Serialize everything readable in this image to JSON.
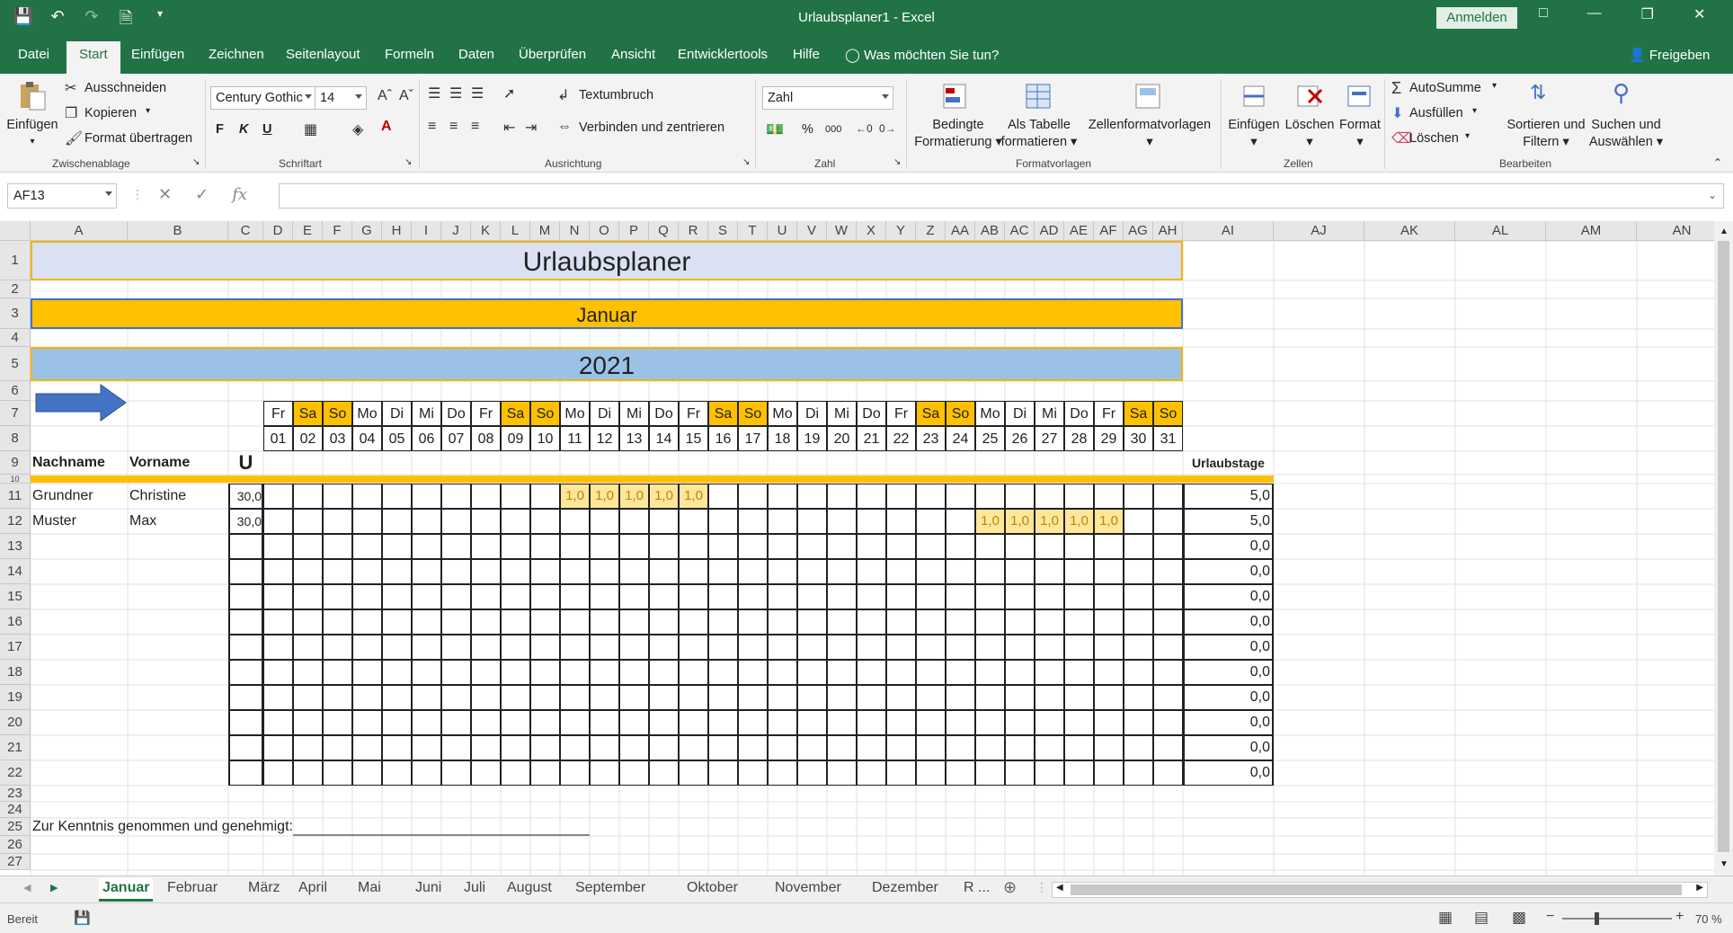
{
  "window": {
    "title": "Urlaubsplaner1  -  Excel",
    "signin": "Anmelden",
    "share": "Freigeben"
  },
  "ribbon_tabs": [
    "Datei",
    "Start",
    "Einfügen",
    "Zeichnen",
    "Seitenlayout",
    "Formeln",
    "Daten",
    "Überprüfen",
    "Ansicht",
    "Entwicklertools",
    "Hilfe",
    "Was möchten Sie tun?"
  ],
  "ribbon": {
    "clipboard": {
      "paste": "Einfügen",
      "cut": "Ausschneiden",
      "copy": "Kopieren",
      "format_painter": "Format übertragen",
      "label": "Zwischenablage"
    },
    "font": {
      "name": "Century Gothic",
      "size": "14",
      "bold": "F",
      "italic": "K",
      "underline": "U",
      "label": "Schriftart"
    },
    "alignment": {
      "wrap": "Textumbruch",
      "merge": "Verbinden und zentrieren",
      "label": "Ausrichtung"
    },
    "number": {
      "format": "Zahl",
      "percent": "%",
      "thousands": "000",
      "label": "Zahl"
    },
    "styles": {
      "conditional_1": "Bedingte",
      "conditional_2": "Formatierung",
      "table_1": "Als Tabelle",
      "table_2": "formatieren",
      "cell_styles": "Zellenformatvorlagen",
      "label": "Formatvorlagen"
    },
    "cells": {
      "insert": "Einfügen",
      "delete": "Löschen",
      "format": "Format",
      "label": "Zellen"
    },
    "editing": {
      "autosum": "AutoSumme",
      "fill": "Ausfüllen",
      "clear": "Löschen",
      "sort_1": "Sortieren und",
      "sort_2": "Filtern",
      "find_1": "Suchen und",
      "find_2": "Auswählen",
      "label": "Bearbeiten"
    }
  },
  "formula_bar": {
    "name_box": "AF13",
    "formula": ""
  },
  "columns": [
    "A",
    "B",
    "C",
    "D",
    "E",
    "F",
    "G",
    "H",
    "I",
    "J",
    "K",
    "L",
    "M",
    "N",
    "O",
    "P",
    "Q",
    "R",
    "S",
    "T",
    "U",
    "V",
    "W",
    "X",
    "Y",
    "Z",
    "AA",
    "AB",
    "AC",
    "AD",
    "AE",
    "AF",
    "AG",
    "AH",
    "AI",
    "AJ",
    "AK",
    "AL",
    "AM",
    "AN"
  ],
  "rows": [
    "1",
    "2",
    "3",
    "4",
    "5",
    "6",
    "7",
    "8",
    "9",
    "10",
    "11",
    "12",
    "13",
    "14",
    "15",
    "16",
    "17",
    "18",
    "19",
    "20",
    "21",
    "22",
    "23",
    "24",
    "25",
    "26",
    "27"
  ],
  "sheet": {
    "title": "Urlaubsplaner",
    "month": "Januar",
    "year": "2021",
    "weekdays": [
      "Fr",
      "Sa",
      "So",
      "Mo",
      "Di",
      "Mi",
      "Do",
      "Fr",
      "Sa",
      "So",
      "Mo",
      "Di",
      "Mi",
      "Do",
      "Fr",
      "Sa",
      "So",
      "Mo",
      "Di",
      "Mi",
      "Do",
      "Fr",
      "Sa",
      "So",
      "Mo",
      "Di",
      "Mi",
      "Do",
      "Fr",
      "Sa",
      "So"
    ],
    "days": [
      "01",
      "02",
      "03",
      "04",
      "05",
      "06",
      "07",
      "08",
      "09",
      "10",
      "11",
      "12",
      "13",
      "14",
      "15",
      "16",
      "17",
      "18",
      "19",
      "20",
      "21",
      "22",
      "23",
      "24",
      "25",
      "26",
      "27",
      "28",
      "29",
      "30",
      "31"
    ],
    "header_lastname": "Nachname",
    "header_firstname": "Vorname",
    "header_u": "U",
    "header_total": "Urlaubstage",
    "people": [
      {
        "last": "Grundner",
        "first": "Christine",
        "u": "30,0",
        "leave_days": [
          "11",
          "12",
          "13",
          "14",
          "15"
        ],
        "leave_value": "1,0",
        "total": "5,0"
      },
      {
        "last": "Muster",
        "first": "Max",
        "u": "30,0",
        "leave_days": [
          "25",
          "26",
          "27",
          "28",
          "29"
        ],
        "leave_value": "1,0",
        "total": "5,0"
      }
    ],
    "empty_totals": [
      "0,0",
      "0,0",
      "0,0",
      "0,0",
      "0,0",
      "0,0",
      "0,0",
      "0,0",
      "0,0",
      "0,0"
    ],
    "approval": "Zur Kenntnis genommen und genehmigt:"
  },
  "sheet_tabs": [
    "Januar",
    "Februar",
    "März",
    "April",
    "Mai",
    "Juni",
    "Juli",
    "August",
    "September",
    "Oktober",
    "November",
    "Dezember",
    "R ..."
  ],
  "status": {
    "ready": "Bereit",
    "zoom": "70 %"
  },
  "colors": {
    "excel_green": "#217346",
    "title_fill": "#d9e1f2",
    "month_fill": "#ffc000",
    "year_fill": "#9bc2e6",
    "weekend_fill": "#ffc000",
    "leave_fill": "#ffe699",
    "arrow": "#4472c4"
  }
}
